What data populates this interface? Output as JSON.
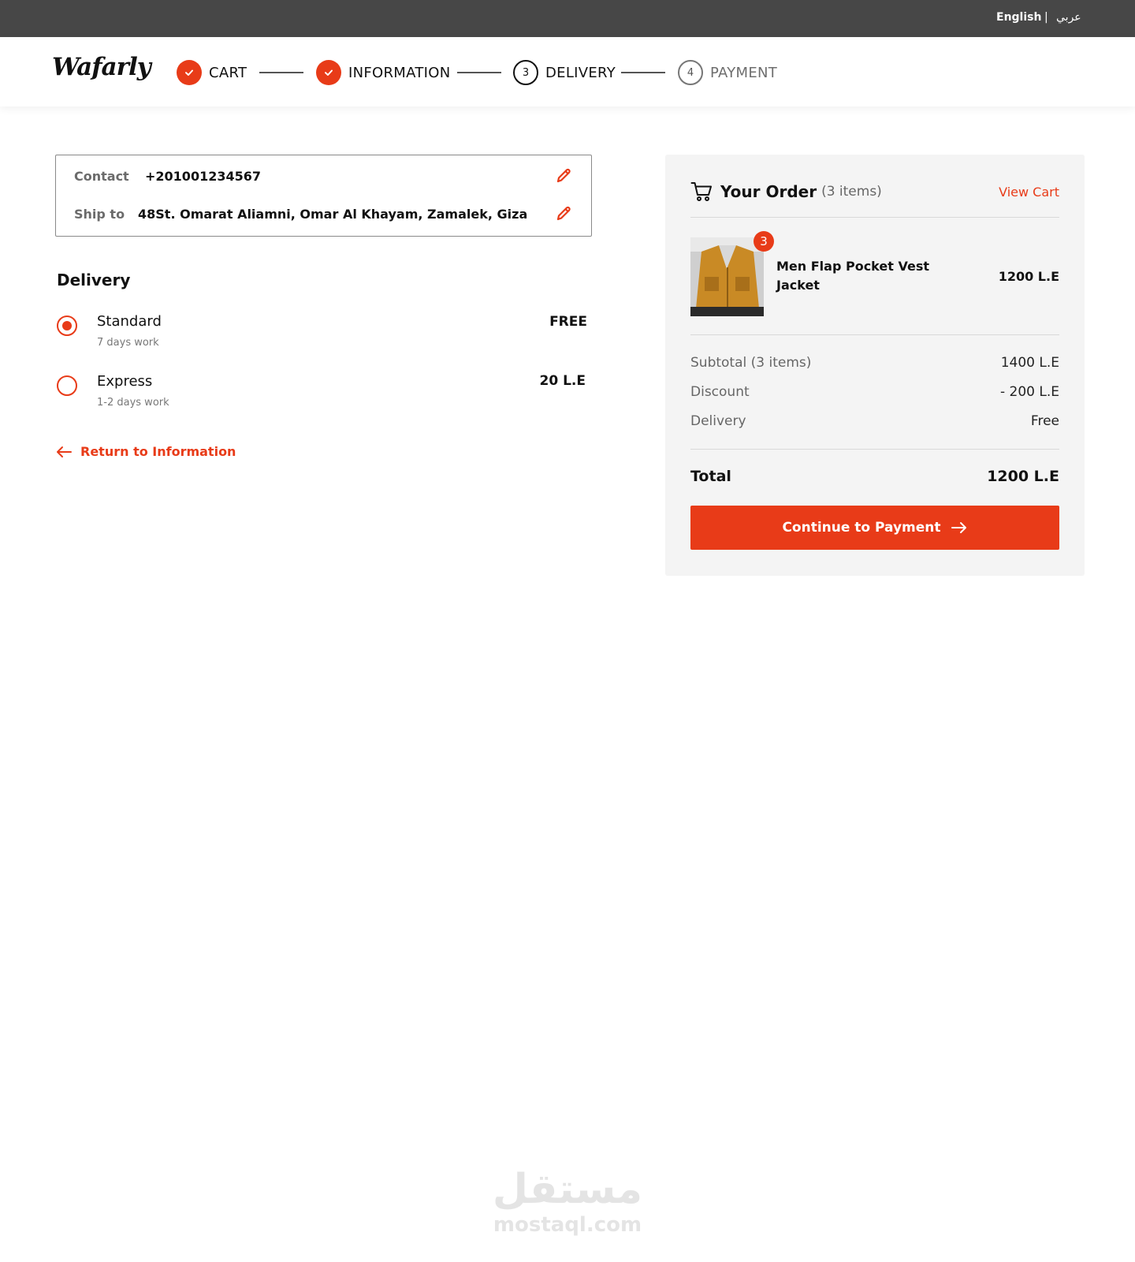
{
  "topbar": {
    "english": "English",
    "separator": "|",
    "arabic": "عربي"
  },
  "brand": {
    "logo": "Wafarly",
    "accent": "#e83b18"
  },
  "steps": [
    {
      "number": "",
      "label": "CART",
      "state": "done"
    },
    {
      "number": "",
      "label": "INFORMATION",
      "state": "done"
    },
    {
      "number": "3",
      "label": "DELIVERY",
      "state": "active"
    },
    {
      "number": "4",
      "label": "PAYMENT",
      "state": "todo"
    }
  ],
  "info": {
    "contact_label": "Contact",
    "contact_value": "+201001234567",
    "ship_label": "Ship to",
    "ship_value": "48St. Omarat Aliamni, Omar Al Khayam, Zamalek, Giza"
  },
  "delivery": {
    "title": "Delivery",
    "options": [
      {
        "name": "Standard",
        "sub": "7 days work",
        "price": "FREE",
        "selected": true
      },
      {
        "name": "Express",
        "sub": "1-2 days work",
        "price": "20 L.E",
        "selected": false
      }
    ],
    "return_label": "Return to Information"
  },
  "order": {
    "title": "Your Order",
    "count": "(3 items)",
    "view_cart": "View Cart",
    "item": {
      "qty": "3",
      "name": "Men Flap Pocket Vest Jacket",
      "price": "1200 L.E"
    },
    "lines": [
      {
        "label": "Subtotal (3 items)",
        "value": "1400 L.E"
      },
      {
        "label": "Discount",
        "value": "- 200 L.E"
      },
      {
        "label": "Delivery",
        "value": "Free"
      }
    ],
    "total_label": "Total",
    "total_value": "1200 L.E",
    "cta": "Continue to Payment"
  },
  "watermark": {
    "arabic": "مستقل",
    "latin": "mostaql.com"
  }
}
